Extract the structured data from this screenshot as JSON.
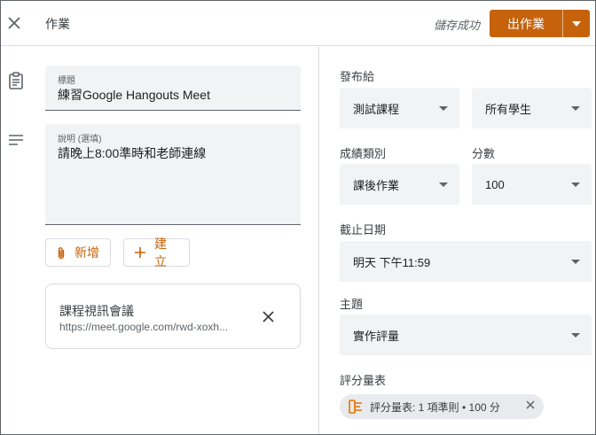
{
  "header": {
    "title": "作業",
    "save_status": "儲存成功",
    "assign_label": "出作業"
  },
  "form": {
    "title_label": "標題",
    "title_value": "練習Google Hangouts Meet",
    "description_label": "說明 (選填)",
    "description_value": "請晚上8:00準時和老師連線",
    "add_label": "新增",
    "create_label": "建立"
  },
  "attachment": {
    "title": "課程視訊會議",
    "url": "https://meet.google.com/rwd-xoxh..."
  },
  "settings": {
    "assign_to_label": "發布給",
    "class_value": "測試課程",
    "students_value": "所有學生",
    "grade_category_label": "成績類別",
    "grade_category_value": "課後作業",
    "points_label": "分數",
    "points_value": "100",
    "due_label": "截止日期",
    "due_value": "明天 下午11:59",
    "topic_label": "主題",
    "topic_value": "實作評量",
    "rubric_label": "評分量表",
    "rubric_chip": "評分量表: 1 項準則 • 100 分"
  },
  "colors": {
    "accent": "#c5620b",
    "field_bg": "#f1f3f4",
    "chip_bg": "#e8eaed"
  }
}
